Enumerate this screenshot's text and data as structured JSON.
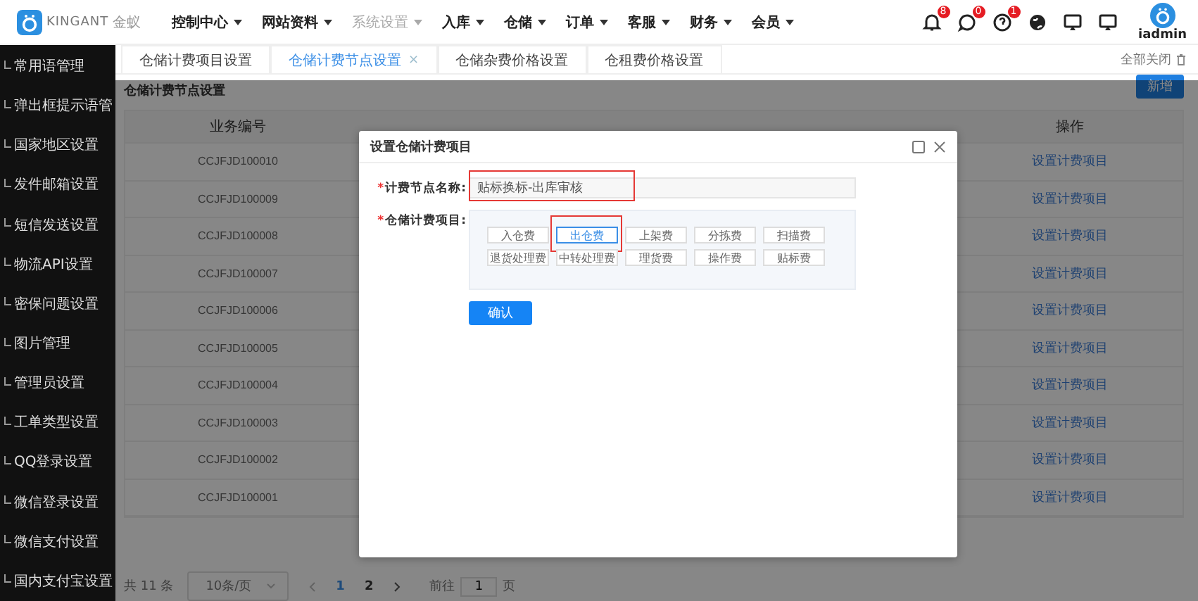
{
  "header": {
    "logo_text": "KINGANT",
    "logo_sub": "金蚁",
    "nav": [
      {
        "label": "控制中心",
        "selected": false
      },
      {
        "label": "网站资料",
        "selected": false
      },
      {
        "label": "系统设置",
        "selected": true
      },
      {
        "label": "入库",
        "selected": false
      },
      {
        "label": "仓储",
        "selected": false
      },
      {
        "label": "订单",
        "selected": false
      },
      {
        "label": "客服",
        "selected": false
      },
      {
        "label": "财务",
        "selected": false
      },
      {
        "label": "会员",
        "selected": false
      }
    ],
    "icons": [
      {
        "kind": "bell",
        "badge": "8"
      },
      {
        "kind": "chat",
        "badge": "0"
      },
      {
        "kind": "help",
        "badge": "1"
      },
      {
        "kind": "globe"
      },
      {
        "kind": "monitor"
      },
      {
        "kind": "monitor"
      }
    ],
    "user": "iadmin"
  },
  "sidebar": {
    "items": [
      "常用语管理",
      "弹出框提示语管",
      "国家地区设置",
      "发件邮箱设置",
      "短信发送设置",
      "物流API设置",
      "密保问题设置",
      "图片管理",
      "管理员设置",
      "工单类型设置",
      "QQ登录设置",
      "微信登录设置",
      "微信支付设置",
      "国内支付宝设置"
    ]
  },
  "tabs": [
    {
      "label": "仓储计费项目设置",
      "selected": false
    },
    {
      "label": "仓储计费节点设置",
      "selected": true,
      "close": "×"
    },
    {
      "label": "仓储杂费价格设置",
      "selected": false
    },
    {
      "label": "仓租费价格设置",
      "selected": false
    }
  ],
  "close_all": "全部关闭",
  "panel": {
    "title": "仓储计费节点设置",
    "add_button": "新增"
  },
  "table": {
    "columns": [
      "业务编号",
      "操作"
    ],
    "rows": [
      {
        "code": "CCJFJD100010",
        "action": "设置计费项目"
      },
      {
        "code": "CCJFJD100009",
        "action": "设置计费项目"
      },
      {
        "code": "CCJFJD100008",
        "action": "设置计费项目"
      },
      {
        "code": "CCJFJD100007",
        "action": "设置计费项目"
      },
      {
        "code": "CCJFJD100006",
        "action": "设置计费项目"
      },
      {
        "code": "CCJFJD100005",
        "action": "设置计费项目"
      },
      {
        "code": "CCJFJD100004",
        "action": "设置计费项目"
      },
      {
        "code": "CCJFJD100003",
        "action": "设置计费项目"
      },
      {
        "code": "CCJFJD100002",
        "action": "设置计费项目"
      },
      {
        "code": "CCJFJD100001",
        "action": "设置计费项目"
      }
    ]
  },
  "pagination": {
    "total": "共 11 条",
    "page_size": "10条/页",
    "pages": [
      {
        "label": "1",
        "selected": true
      },
      {
        "label": "2",
        "selected": false
      }
    ],
    "goto_label": "前往",
    "goto_value": "1",
    "page_suffix": "页"
  },
  "dialog": {
    "title": "设置仓储计费项目",
    "fields": [
      {
        "kind": "input",
        "mark": "*",
        "label": "计费节点名称:",
        "value": "贴标换标-出库审核",
        "highlighted": true
      },
      {
        "kind": "options",
        "mark": "*",
        "label": "仓储计费项目:",
        "options": [
          {
            "label": "入仓费",
            "selected": false,
            "highlighted": false
          },
          {
            "label": "出仓费",
            "selected": true,
            "highlighted": true
          },
          {
            "label": "上架费",
            "selected": false,
            "highlighted": false
          },
          {
            "label": "分拣费",
            "selected": false,
            "highlighted": false
          },
          {
            "label": "扫描费",
            "selected": false,
            "highlighted": false
          },
          {
            "label": "退货处理费",
            "selected": false,
            "highlighted": false
          },
          {
            "label": "中转处理费",
            "selected": false,
            "highlighted": false
          },
          {
            "label": "理货费",
            "selected": false,
            "highlighted": false
          },
          {
            "label": "操作费",
            "selected": false,
            "highlighted": false
          },
          {
            "label": "贴标费",
            "selected": false,
            "highlighted": false
          }
        ]
      }
    ],
    "confirm": "确认"
  }
}
